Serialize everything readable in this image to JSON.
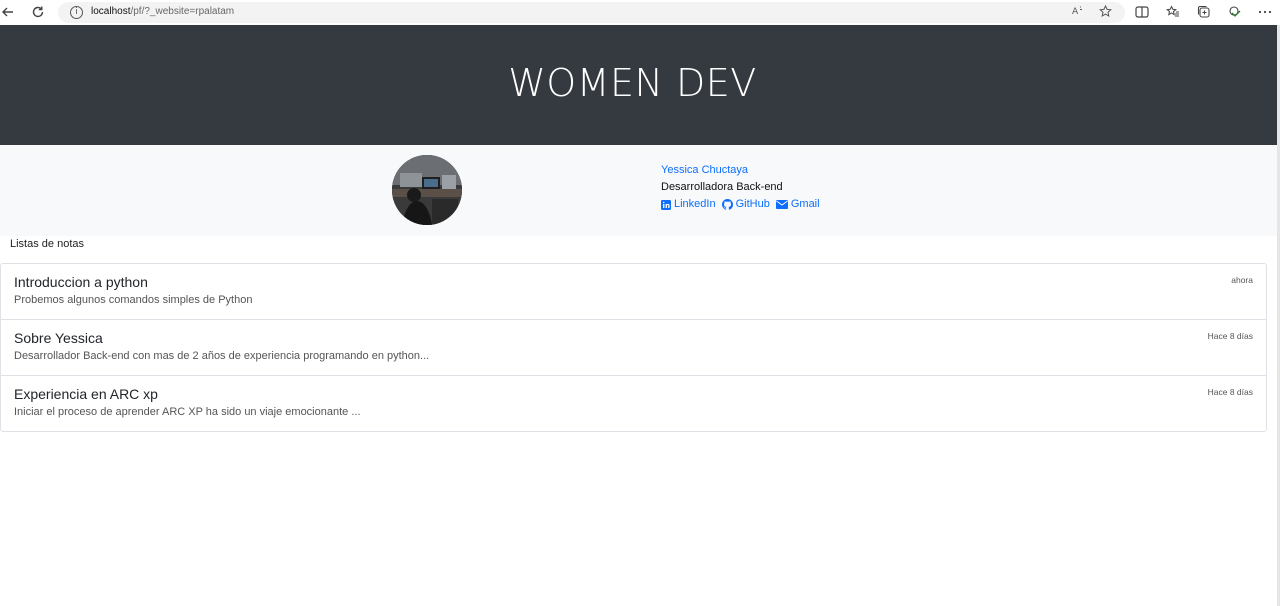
{
  "browser": {
    "url_host": "localhost",
    "url_path": "/pf/?_website=rpalatam",
    "read_aloud_label": "A̅"
  },
  "header": {
    "title": "WOMEN DEV"
  },
  "profile": {
    "name": "Yessica Chuctaya",
    "role": "Desarrolladora Back-end",
    "links": [
      {
        "label": "LinkedIn",
        "icon": "linkedin-icon"
      },
      {
        "label": "GitHub",
        "icon": "github-icon"
      },
      {
        "label": "Gmail",
        "icon": "mail-icon"
      }
    ]
  },
  "notes": {
    "section_label": "Listas de notas",
    "items": [
      {
        "title": "Introduccion a python",
        "description": "Probemos algunos comandos simples de Python",
        "time": "ahora"
      },
      {
        "title": "Sobre Yessica",
        "description": "Desarrollador Back-end con mas de 2 años de experiencia programando en python...",
        "time": "Hace 8 días"
      },
      {
        "title": "Experiencia en ARC xp",
        "description": "Iniciar el proceso de aprender ARC XP ha sido un viaje emocionante ...",
        "time": "Hace 8 días"
      }
    ]
  },
  "colors": {
    "header_bg": "#343a40",
    "link": "#0d6efd",
    "band_bg": "#f8f9fa"
  }
}
